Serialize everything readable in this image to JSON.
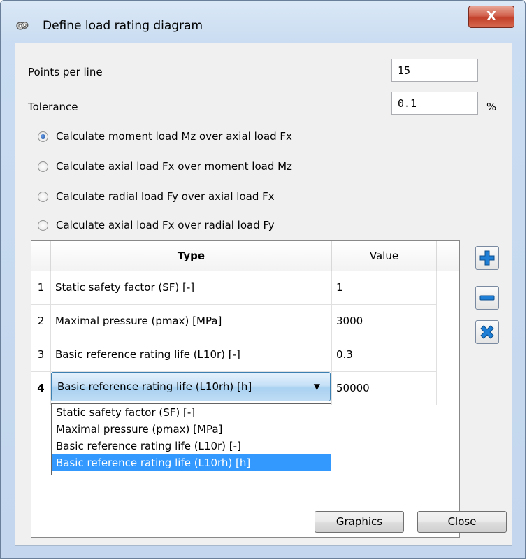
{
  "window": {
    "title": "Define load rating diagram",
    "close_glyph": "X",
    "icon": "gear-icon"
  },
  "fields": {
    "points_label": "Points per line",
    "points_value": "15",
    "tolerance_label": "Tolerance",
    "tolerance_value": "0.1",
    "tolerance_unit": "%"
  },
  "radios": [
    {
      "label": "Calculate moment load Mz over axial load Fx",
      "checked": true
    },
    {
      "label": "Calculate axial load Fx over moment load Mz",
      "checked": false
    },
    {
      "label": "Calculate radial load Fy over axial load Fx",
      "checked": false
    },
    {
      "label": "Calculate axial load Fx over radial load Fy",
      "checked": false
    }
  ],
  "table": {
    "headers": {
      "type": "Type",
      "value": "Value"
    },
    "rows": [
      {
        "num": "1",
        "type": "Static safety factor (SF) [-]",
        "value": "1"
      },
      {
        "num": "2",
        "type": "Maximal pressure (pmax) [MPa]",
        "value": "3000"
      },
      {
        "num": "3",
        "type": "Basic reference rating life (L10r) [-]",
        "value": "0.3"
      },
      {
        "num": "4",
        "type": "Basic reference rating life (L10rh) [h]",
        "value": "50000"
      }
    ],
    "dropdown_arrow": "▼",
    "dropdown_options": [
      "Static safety factor (SF) [-]",
      "Maximal pressure (pmax) [MPa]",
      "Basic reference rating life (L10r) [-]",
      "Basic reference rating life (L10rh) [h]"
    ],
    "dropdown_selected_index": 3
  },
  "tools": {
    "add": "plus-icon",
    "remove": "minus-icon",
    "delete": "x-icon"
  },
  "buttons": {
    "graphics": "Graphics",
    "close": "Close"
  },
  "colors": {
    "selection": "#3399ff",
    "tool_icon": "#1f7fd6"
  }
}
